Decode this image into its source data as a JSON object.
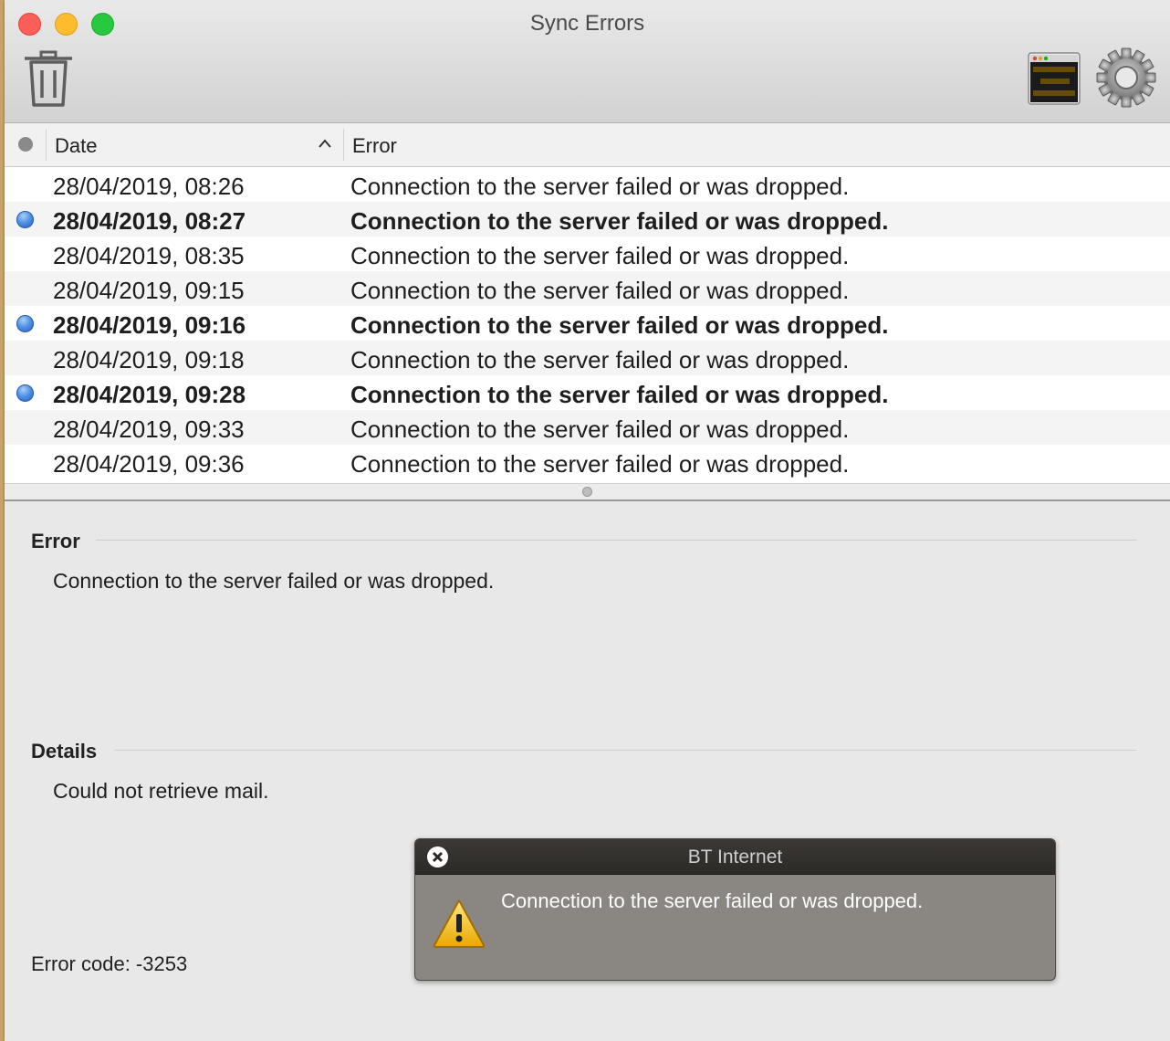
{
  "window": {
    "title": "Sync Errors"
  },
  "toolbar": {
    "trash_icon": "trash-icon",
    "console_icon": "console-icon",
    "gear_icon": "gear-icon"
  },
  "table": {
    "columns": {
      "status": "",
      "date": "Date",
      "error": "Error"
    },
    "sort": {
      "column": "Date",
      "direction": "ascending"
    },
    "rows": [
      {
        "date": "28/04/2019, 08:26",
        "error": "Connection to the server failed or was dropped.",
        "unread": false
      },
      {
        "date": "28/04/2019, 08:27",
        "error": "Connection to the server failed or was dropped.",
        "unread": true
      },
      {
        "date": "28/04/2019, 08:35",
        "error": "Connection to the server failed or was dropped.",
        "unread": false
      },
      {
        "date": "28/04/2019, 09:15",
        "error": "Connection to the server failed or was dropped.",
        "unread": false
      },
      {
        "date": "28/04/2019, 09:16",
        "error": "Connection to the server failed or was dropped.",
        "unread": true
      },
      {
        "date": "28/04/2019, 09:18",
        "error": "Connection to the server failed or was dropped.",
        "unread": false
      },
      {
        "date": "28/04/2019, 09:28",
        "error": "Connection to the server failed or was dropped.",
        "unread": true
      },
      {
        "date": "28/04/2019, 09:33",
        "error": "Connection to the server failed or was dropped.",
        "unread": false
      },
      {
        "date": "28/04/2019, 09:36",
        "error": "Connection to the server failed or was dropped.",
        "unread": false
      }
    ]
  },
  "detail": {
    "error_heading": "Error",
    "error_text": "Connection to the server failed or was dropped.",
    "details_heading": "Details",
    "details_text": "Could not retrieve mail.",
    "error_code": "Error code: -3253"
  },
  "notification": {
    "title": "BT Internet",
    "message": "Connection to the server failed or was dropped.",
    "icon": "warning-icon",
    "close_icon": "close-icon"
  },
  "colors": {
    "unread_dot": "#4e8fe4",
    "notification_bg": "#8a8682",
    "warning": "#f5b800"
  }
}
